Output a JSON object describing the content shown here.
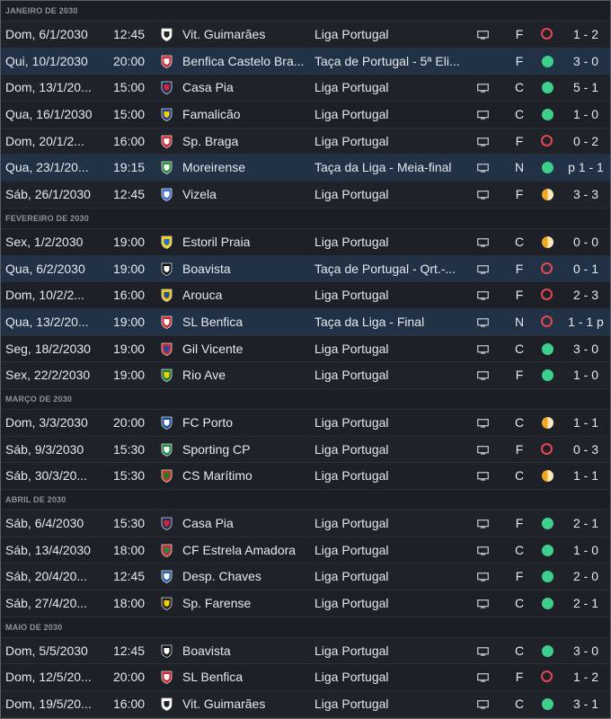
{
  "colors": {
    "win": "#3fcf8c",
    "loss": "#e5474f",
    "draw": "#f0a623",
    "cup_row": "#213247"
  },
  "months": [
    {
      "label": "JANEIRO DE 2030",
      "matches": [
        {
          "date": "Dom, 6/1/2030",
          "time": "12:45",
          "crest": "vitoria-crest-icon",
          "team": "Vit. Guimarães",
          "competition": "Liga Portugal",
          "tv": true,
          "venue": "F",
          "result": "loss",
          "score": "1 - 2",
          "cup": false
        },
        {
          "date": "Qui, 10/1/2030",
          "time": "20:00",
          "crest": "benfica-crest-icon",
          "team": "Benfica Castelo Bra...",
          "competition": "Taça de Portugal - 5ª Eli...",
          "tv": false,
          "venue": "F",
          "result": "win",
          "score": "3 - 0",
          "cup": true
        },
        {
          "date": "Dom, 13/1/20...",
          "time": "15:00",
          "crest": "casapia-crest-icon",
          "team": "Casa Pia",
          "competition": "Liga Portugal",
          "tv": true,
          "venue": "C",
          "result": "win",
          "score": "5 - 1",
          "cup": false
        },
        {
          "date": "Qua, 16/1/2030",
          "time": "15:00",
          "crest": "famalicao-crest-icon",
          "team": "Famalicão",
          "competition": "Liga Portugal",
          "tv": true,
          "venue": "C",
          "result": "win",
          "score": "1 - 0",
          "cup": false
        },
        {
          "date": "Dom, 20/1/2...",
          "time": "16:00",
          "crest": "braga-crest-icon",
          "team": "Sp. Braga",
          "competition": "Liga Portugal",
          "tv": true,
          "venue": "F",
          "result": "loss",
          "score": "0 - 2",
          "cup": false
        },
        {
          "date": "Qua, 23/1/20...",
          "time": "19:15",
          "crest": "moreirense-crest-icon",
          "team": "Moreirense",
          "competition": "Taça da Liga - Meia-final",
          "tv": true,
          "venue": "N",
          "result": "win",
          "score": "p 1 - 1",
          "cup": true
        },
        {
          "date": "Sáb, 26/1/2030",
          "time": "12:45",
          "crest": "vizela-crest-icon",
          "team": "Vizela",
          "competition": "Liga Portugal",
          "tv": true,
          "venue": "F",
          "result": "draw",
          "score": "3 - 3",
          "cup": false
        }
      ]
    },
    {
      "label": "FEVEREIRO DE 2030",
      "matches": [
        {
          "date": "Sex, 1/2/2030",
          "time": "19:00",
          "crest": "estoril-crest-icon",
          "team": "Estoril Praia",
          "competition": "Liga Portugal",
          "tv": true,
          "venue": "C",
          "result": "draw",
          "score": "0 - 0",
          "cup": false
        },
        {
          "date": "Qua, 6/2/2030",
          "time": "19:00",
          "crest": "boavista-crest-icon",
          "team": "Boavista",
          "competition": "Taça de Portugal - Qrt.-...",
          "tv": true,
          "venue": "F",
          "result": "loss",
          "score": "0 - 1",
          "cup": true
        },
        {
          "date": "Dom, 10/2/2...",
          "time": "16:00",
          "crest": "arouca-crest-icon",
          "team": "Arouca",
          "competition": "Liga Portugal",
          "tv": true,
          "venue": "F",
          "result": "loss",
          "score": "2 - 3",
          "cup": false
        },
        {
          "date": "Qua, 13/2/20...",
          "time": "19:00",
          "crest": "benfica-crest-icon",
          "team": "SL Benfica",
          "competition": "Taça da Liga - Final",
          "tv": true,
          "venue": "N",
          "result": "loss",
          "score": "1 - 1 p",
          "cup": true
        },
        {
          "date": "Seg, 18/2/2030",
          "time": "19:00",
          "crest": "gilvicente-crest-icon",
          "team": "Gil Vicente",
          "competition": "Liga Portugal",
          "tv": true,
          "venue": "C",
          "result": "win",
          "score": "3 - 0",
          "cup": false
        },
        {
          "date": "Sex, 22/2/2030",
          "time": "19:00",
          "crest": "rioave-crest-icon",
          "team": "Rio Ave",
          "competition": "Liga Portugal",
          "tv": true,
          "venue": "F",
          "result": "win",
          "score": "1 - 0",
          "cup": false
        }
      ]
    },
    {
      "label": "MARÇO DE 2030",
      "matches": [
        {
          "date": "Dom, 3/3/2030",
          "time": "20:00",
          "crest": "porto-crest-icon",
          "team": "FC Porto",
          "competition": "Liga Portugal",
          "tv": true,
          "venue": "C",
          "result": "draw",
          "score": "1 - 1",
          "cup": false
        },
        {
          "date": "Sáb, 9/3/2030",
          "time": "15:30",
          "crest": "sporting-crest-icon",
          "team": "Sporting CP",
          "competition": "Liga Portugal",
          "tv": true,
          "venue": "F",
          "result": "loss",
          "score": "0 - 3",
          "cup": false
        },
        {
          "date": "Sáb, 30/3/20...",
          "time": "15:30",
          "crest": "maritimo-crest-icon",
          "team": "CS Marítimo",
          "competition": "Liga Portugal",
          "tv": true,
          "venue": "C",
          "result": "draw",
          "score": "1 - 1",
          "cup": false
        }
      ]
    },
    {
      "label": "ABRIL DE 2030",
      "matches": [
        {
          "date": "Sáb, 6/4/2030",
          "time": "15:30",
          "crest": "casapia-crest-icon",
          "team": "Casa Pia",
          "competition": "Liga Portugal",
          "tv": true,
          "venue": "F",
          "result": "win",
          "score": "2 - 1",
          "cup": false
        },
        {
          "date": "Sáb, 13/4/2030",
          "time": "18:00",
          "crest": "amadora-crest-icon",
          "team": "CF Estrela Amadora",
          "competition": "Liga Portugal",
          "tv": true,
          "venue": "C",
          "result": "win",
          "score": "1 - 0",
          "cup": false
        },
        {
          "date": "Sáb, 20/4/20...",
          "time": "12:45",
          "crest": "chaves-crest-icon",
          "team": "Desp. Chaves",
          "competition": "Liga Portugal",
          "tv": true,
          "venue": "F",
          "result": "win",
          "score": "2 - 0",
          "cup": false
        },
        {
          "date": "Sáb, 27/4/20...",
          "time": "18:00",
          "crest": "farense-crest-icon",
          "team": "Sp. Farense",
          "competition": "Liga Portugal",
          "tv": true,
          "venue": "C",
          "result": "win",
          "score": "2 - 1",
          "cup": false
        }
      ]
    },
    {
      "label": "MAIO DE 2030",
      "matches": [
        {
          "date": "Dom, 5/5/2030",
          "time": "12:45",
          "crest": "boavista-crest-icon",
          "team": "Boavista",
          "competition": "Liga Portugal",
          "tv": true,
          "venue": "C",
          "result": "win",
          "score": "3 - 0",
          "cup": false
        },
        {
          "date": "Dom, 12/5/20...",
          "time": "20:00",
          "crest": "benfica-crest-icon",
          "team": "SL Benfica",
          "competition": "Liga Portugal",
          "tv": true,
          "venue": "F",
          "result": "loss",
          "score": "1 - 2",
          "cup": false
        },
        {
          "date": "Dom, 19/5/20...",
          "time": "16:00",
          "crest": "vitoria-crest-icon",
          "team": "Vit. Guimarães",
          "competition": "Liga Portugal",
          "tv": true,
          "venue": "C",
          "result": "win",
          "score": "3 - 1",
          "cup": false
        }
      ]
    }
  ]
}
